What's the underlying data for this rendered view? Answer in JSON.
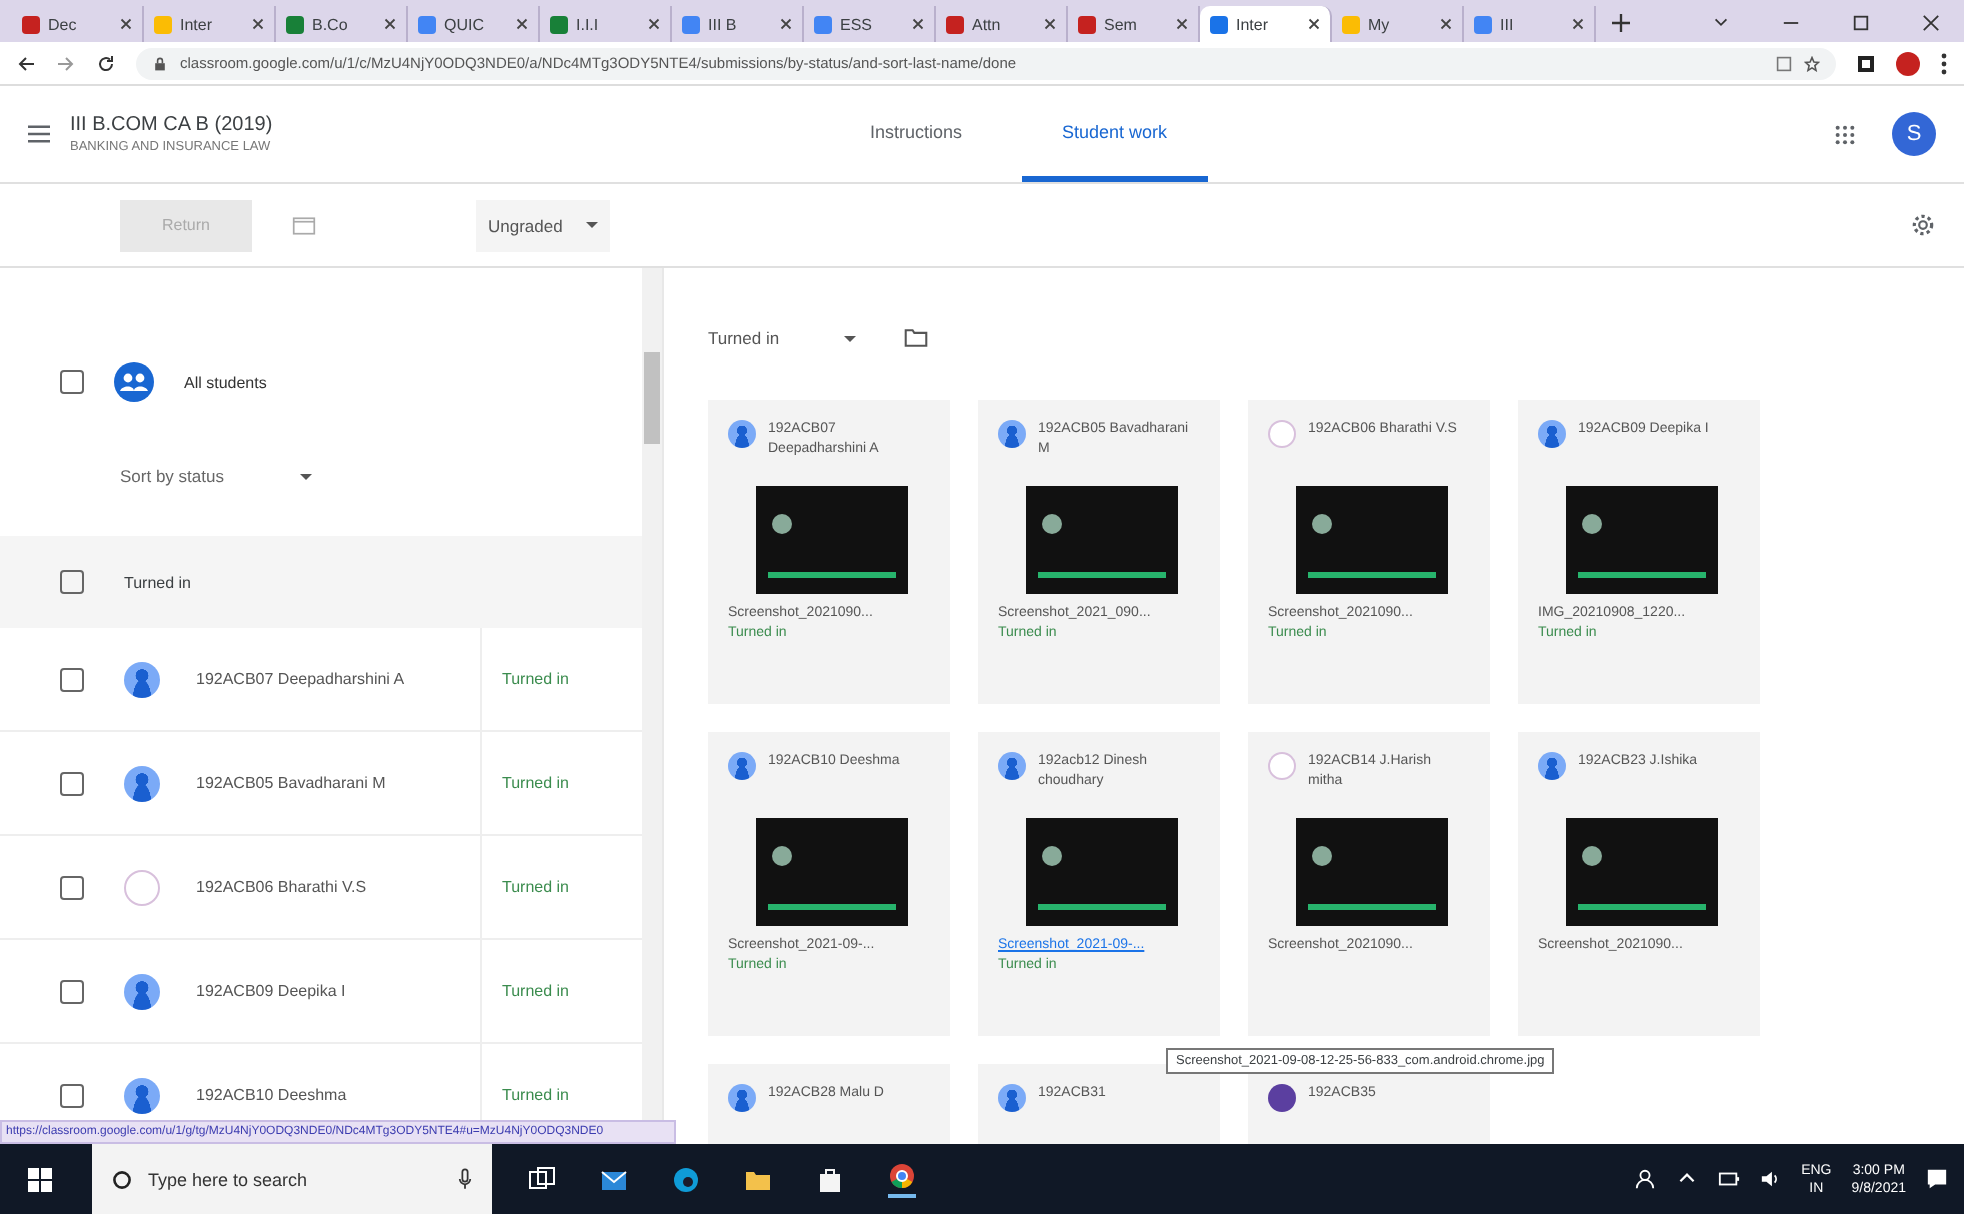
{
  "browser": {
    "tabs": [
      {
        "title": "Dec",
        "color": "#c5221f",
        "selected": false
      },
      {
        "title": "Inter",
        "color": "#fbbc04",
        "selected": false
      },
      {
        "title": "B.Co",
        "color": "#188038",
        "selected": false
      },
      {
        "title": "QUIC",
        "color": "#4285f4",
        "selected": false
      },
      {
        "title": "I.I.I",
        "color": "#188038",
        "selected": false
      },
      {
        "title": "III B",
        "color": "#4285f4",
        "selected": false
      },
      {
        "title": "ESS",
        "color": "#4285f4",
        "selected": false
      },
      {
        "title": "Attn",
        "color": "#c5221f",
        "selected": false
      },
      {
        "title": "Sem",
        "color": "#c5221f",
        "selected": false
      },
      {
        "title": "Inter",
        "color": "#1a73e8",
        "selected": true
      },
      {
        "title": "My",
        "color": "#fbbc04",
        "selected": false
      },
      {
        "title": "III",
        "color": "#4285f4",
        "selected": false
      }
    ],
    "url": "classroom.google.com/u/1/c/MzU4NjY0ODQ3NDE0/a/NDc4MTg3ODY5NTE4/submissions/by-status/and-sort-last-name/done"
  },
  "header": {
    "class_title": "III B.COM CA B (2019)",
    "subject": "BANKING AND INSURANCE LAW",
    "tabs": [
      {
        "label": "Instructions",
        "selected": false
      },
      {
        "label": "Student work",
        "selected": true
      }
    ],
    "avatar_letter": "S"
  },
  "toolbar": {
    "return_button": {
      "label": "Return",
      "disabled": true
    },
    "grade_filter": "Ungraded"
  },
  "student_list": {
    "all_students": {
      "label": "All students",
      "checked": false
    },
    "sort": "Sort by status",
    "group": {
      "label": "Turned in",
      "checked": false
    },
    "rows": [
      {
        "name": "192ACB07 Deepadharshini A",
        "status": "Turned in",
        "kind": "person",
        "checked": false
      },
      {
        "name": "192ACB05 Bavadharani M",
        "status": "Turned in",
        "kind": "person",
        "checked": false
      },
      {
        "name": "192ACB06 Bharathi V.S",
        "status": "Turned in",
        "kind": "photo",
        "checked": false
      },
      {
        "name": "192ACB09 Deepika I",
        "status": "Turned in",
        "kind": "person",
        "checked": false
      },
      {
        "name": "192ACB10 Deeshma",
        "status": "Turned in",
        "kind": "person",
        "checked": false
      }
    ]
  },
  "submissions": {
    "filter": "Turned in",
    "cards": [
      {
        "name": "192ACB07 Deepadharshini A",
        "kind": "person",
        "file": "Screenshot_2021090...",
        "hovered": false,
        "status": "Turned in"
      },
      {
        "name": "192ACB05 Bavadharani M",
        "kind": "person",
        "file": "Screenshot_2021_090...",
        "hovered": false,
        "status": "Turned in"
      },
      {
        "name": "192ACB06 Bharathi V.S",
        "kind": "photo",
        "file": "Screenshot_2021090...",
        "hovered": false,
        "status": "Turned in"
      },
      {
        "name": "192ACB09 Deepika I",
        "kind": "person",
        "file": "IMG_20210908_1220...",
        "hovered": false,
        "status": "Turned in"
      },
      {
        "name": "192ACB10 Deeshma",
        "kind": "person",
        "file": "Screenshot_2021-09-...",
        "hovered": false,
        "status": "Turned in"
      },
      {
        "name": "192acb12 Dinesh choudhary",
        "kind": "person",
        "file": "Screenshot_2021-09-...",
        "hovered": true,
        "status": "Turned in"
      },
      {
        "name": "192ACB14 J.Harish mitha",
        "kind": "photo",
        "file": "Screenshot_2021090...",
        "hovered": false
      },
      {
        "name": "192ACB23 J.Ishika",
        "kind": "person",
        "file": "Screenshot_2021090...",
        "hovered": false
      },
      {
        "name": "192ACB28 Malu D",
        "kind": "person"
      },
      {
        "name": "192ACB31",
        "kind": "person"
      },
      {
        "name": "192ACB35",
        "kind": "dark"
      }
    ]
  },
  "tooltip": "Screenshot_2021-09-08-12-25-56-833_com.android.chrome.jpg",
  "status_link": "https://classroom.google.com/u/1/g/tg/MzU4NjY0ODQ3NDE0/NDc4MTg3ODY5NTE4#u=MzU4NjY0ODQ3NDE0",
  "taskbar": {
    "search_placeholder": "Type here to search",
    "language": "ENG",
    "region": "IN",
    "time": "3:00 PM",
    "date": "9/8/2021"
  }
}
